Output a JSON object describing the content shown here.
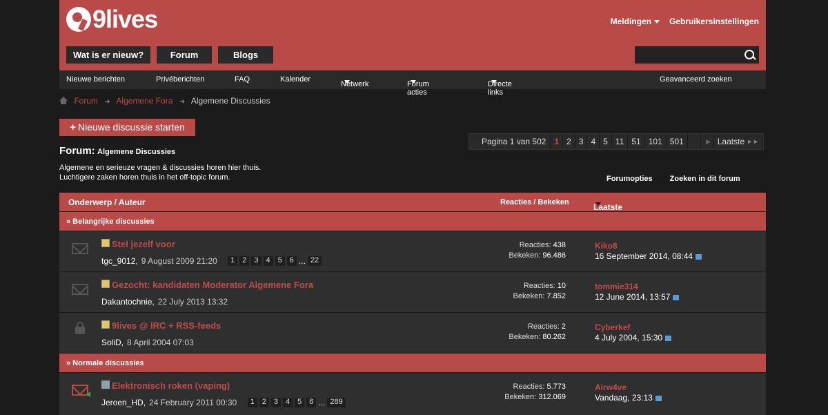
{
  "header": {
    "logo_text": "9lives",
    "meldingen": "Meldingen",
    "gebruikersinstellingen": "Gebruikersinstellingen",
    "tabs": [
      "Wat is er nieuw?",
      "Forum",
      "Blogs"
    ]
  },
  "subnav": {
    "items": [
      "Nieuwe berichten",
      "Privéberichten",
      "FAQ",
      "Kalender",
      "Netwerk",
      "Forum acties",
      "Directe links",
      "Geavanceerd zoeken"
    ]
  },
  "breadcrumb": {
    "forum": "Forum",
    "algemene_fora": "Algemene Fora",
    "current": "Algemene Discussies"
  },
  "new_thread_button": "Nieuwe discussie starten",
  "forum": {
    "label": "Forum:",
    "name": "Algemene Discussies",
    "desc_line1": "Algemene en serieuze vragen & discussies horen hier thuis.",
    "desc_line2": "Luchtigere zaken horen thuis in het off-topic forum."
  },
  "pager": {
    "label": "Pagina 1 van 502",
    "pages": [
      "1",
      "2",
      "3",
      "4",
      "5",
      "11",
      "51",
      "101",
      "501"
    ],
    "current": "1",
    "last_label": "Laatste"
  },
  "forumoptions": {
    "opties": "Forumopties",
    "zoeken": "Zoeken in dit forum"
  },
  "table_header": {
    "subject": "Onderwerp / Auteur",
    "replies_views": "Reacties / Bekeken",
    "last_post": "Laatste bericht door"
  },
  "sections": {
    "sticky": "» Belangrijke discussies",
    "normal": "» Normale discussies"
  },
  "threads": [
    {
      "title": "Stel jezelf voor",
      "author": "tgc_9012,",
      "date": "9 August 2009 21:20",
      "pages": [
        "1",
        "2",
        "3",
        "4",
        "5",
        "6",
        "...",
        "22"
      ],
      "replies_label": "Reacties:",
      "replies": "438",
      "views_label": "Bekeken:",
      "views": "96.486",
      "last_user": "Kiko8",
      "last_time": "16 September 2014, 08:44"
    },
    {
      "title": "Gezocht: kandidaten Moderator Algemene Fora",
      "author": "Dakantochnie,",
      "date": "22 July 2013 13:32",
      "pages": [],
      "replies_label": "Reacties:",
      "replies": "10",
      "views_label": "Bekeken:",
      "views": "7.852",
      "last_user": "tommie314",
      "last_time": "12 June 2014, 13:57"
    },
    {
      "title": "9lives @ IRC + RSS-feeds",
      "author": "SoliD,",
      "date": "8 April 2004 07:03",
      "pages": [],
      "replies_label": "Reacties:",
      "replies": "2",
      "views_label": "Bekeken:",
      "views": "80.262",
      "last_user": "Cyberkef",
      "last_time": "4 July 2004, 15:30"
    },
    {
      "title": "Elektronisch roken (vaping)",
      "author": "Jeroen_HD,",
      "date": "24 February 2011 00:30",
      "pages": [
        "1",
        "2",
        "3",
        "4",
        "5",
        "6",
        "...",
        "289"
      ],
      "replies_label": "Reacties:",
      "replies": "5.773",
      "views_label": "Bekeken:",
      "views": "312.069",
      "last_user": "Airw4ve",
      "last_time": "Vandaag, 23:13"
    }
  ],
  "colors": {
    "accent": "#b94a48",
    "background": "#1b1b1b",
    "row": "#2f2f2f"
  }
}
